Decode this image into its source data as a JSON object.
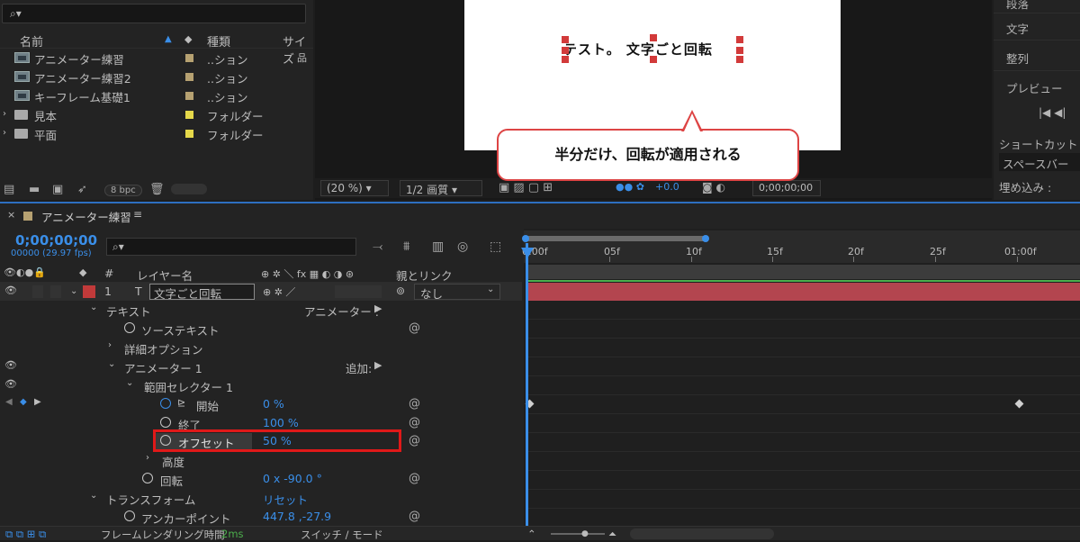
{
  "project": {
    "search_placeholder": "",
    "columns": {
      "name": "名前",
      "type": "種類",
      "size": "サイズ"
    },
    "items": [
      {
        "name": "アニメーター練習",
        "type": "..ション",
        "kind": "comp",
        "color": "#b6a171"
      },
      {
        "name": "アニメーター練習2",
        "type": "..ション",
        "kind": "comp",
        "color": "#b6a171"
      },
      {
        "name": "キーフレーム基礎1",
        "type": "..ション",
        "kind": "comp",
        "color": "#b6a171"
      },
      {
        "name": "見本",
        "type": "フォルダー",
        "kind": "folder",
        "color": "#e5d84a"
      },
      {
        "name": "平面",
        "type": "フォルダー",
        "kind": "folder",
        "color": "#e5d84a"
      }
    ],
    "bpc": "8 bpc"
  },
  "viewer": {
    "canvas_text": "テスト。 文字ごと回転",
    "zoom": "(20 %)",
    "quality": "1/2 画質",
    "exposure": "+0.0",
    "timecode": "0;00;00;00"
  },
  "callout": {
    "text": "半分だけ、回転が適用される"
  },
  "right_panel": {
    "items": [
      "段落",
      "文字",
      "整列",
      "プレビュー"
    ],
    "shortcut_label": "ショートカット",
    "shortcut_value": "スペースバー",
    "include_label": "埋め込み :"
  },
  "timeline": {
    "tab_label": "アニメーター練習",
    "timecode": "0;00;00;00",
    "frames_fps": "00000 (29.97 fps)",
    "columns": {
      "num": "#",
      "layer_name": "レイヤー名",
      "parent": "親とリンク"
    },
    "layer": {
      "num": "1",
      "type": "T",
      "name": "文字ごと回転",
      "parent": "なし"
    },
    "props": {
      "text": "テキスト",
      "animator_menu": "アニメーター :",
      "source_text": "ソーステキスト",
      "more_options": "詳細オプション",
      "animator1": "アニメーター 1",
      "add": "追加:",
      "range_selector": "範囲セレクター 1",
      "start": "開始",
      "start_val": "0 %",
      "end": "終了",
      "end_val": "100 %",
      "offset": "オフセット",
      "offset_val": "50 %",
      "advanced": "高度",
      "rotation": "回転",
      "rotation_val": "0 x -90.0 °",
      "transform": "トランスフォーム",
      "reset": "リセット",
      "anchor": "アンカーポイント",
      "anchor_val": "447.8 ,-27.9"
    },
    "ruler": [
      "0:00f",
      "05f",
      "10f",
      "15f",
      "20f",
      "25f",
      "01:00f"
    ]
  },
  "bottom": {
    "render_label": "フレームレンダリング時間",
    "render_value": "2ms",
    "switch_mode": "スイッチ / モード"
  }
}
